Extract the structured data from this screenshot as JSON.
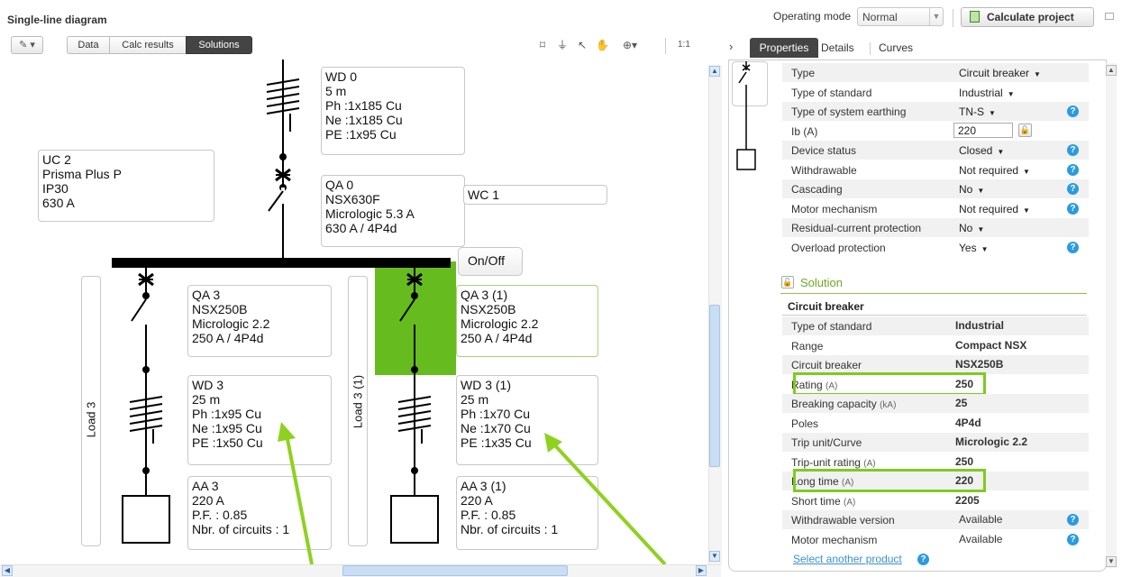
{
  "app": {
    "title": "Single-line diagram"
  },
  "topbar": {
    "operating_mode_label": "Operating mode",
    "operating_mode_value": "Normal",
    "calculate_label": "Calculate project"
  },
  "toolbar": {
    "tabs": [
      "Data",
      "Calc results",
      "Solutions"
    ],
    "active_tab": "Solutions",
    "zoom_reset": "1:1"
  },
  "diagram": {
    "wd0": [
      "WD 0",
      "5 m",
      "Ph :1x185 Cu",
      "Ne :1x185 Cu",
      "PE :1x95 Cu"
    ],
    "uc2": [
      "UC 2",
      "Prisma Plus P",
      "IP30",
      "630 A"
    ],
    "qa0": [
      "QA 0",
      "NSX630F",
      "Micrologic 5.3 A",
      "630 A / 4P4d"
    ],
    "wc1": "WC 1",
    "onoff": "On/Off",
    "qa3": [
      "QA 3",
      "NSX250B",
      "Micrologic 2.2",
      "250 A / 4P4d"
    ],
    "qa3_1": [
      "QA 3 (1)",
      "NSX250B",
      "Micrologic 2.2",
      "250 A / 4P4d"
    ],
    "wd3": [
      "WD 3",
      "25 m",
      "Ph :1x95 Cu",
      "Ne :1x95 Cu",
      "PE :1x50 Cu"
    ],
    "wd3_1": [
      "WD 3 (1)",
      "25 m",
      "Ph :1x70 Cu",
      "Ne :1x70 Cu",
      "PE :1x35 Cu"
    ],
    "aa3": [
      "AA 3",
      "220 A",
      "P.F. : 0.85",
      "Nbr. of circuits : 1"
    ],
    "aa3_1": [
      "AA 3 (1)",
      "220 A",
      "P.F. : 0.85",
      "Nbr. of circuits : 1"
    ],
    "load3": "Load 3",
    "load3_1": "Load 3 (1)",
    "selected_fill_color": "#66bb1e",
    "arrow_color": "#8fd11f"
  },
  "panel": {
    "tabs": [
      "Properties",
      "Details",
      "Curves"
    ],
    "active_tab": "Properties",
    "properties": [
      {
        "label": "Type",
        "value": "Circuit breaker",
        "dropdown": true,
        "help": false
      },
      {
        "label": "Type of standard",
        "value": "Industrial",
        "dropdown": true,
        "help": false
      },
      {
        "label": "Type of system earthing",
        "value": "TN-S",
        "dropdown": true,
        "help": true
      },
      {
        "label": "Ib (A)",
        "value": "220",
        "input": true,
        "help": false
      },
      {
        "label": "Device status",
        "value": "Closed",
        "dropdown": true,
        "help": true
      },
      {
        "label": "Withdrawable",
        "value": "Not required",
        "dropdown": true,
        "help": true
      },
      {
        "label": "Cascading",
        "value": "No",
        "dropdown": true,
        "help": true
      },
      {
        "label": "Motor mechanism",
        "value": "Not required",
        "dropdown": true,
        "help": true
      },
      {
        "label": "Residual-current protection",
        "value": "No",
        "dropdown": true,
        "help": false
      },
      {
        "label": "Overload protection",
        "value": "Yes",
        "dropdown": true,
        "help": true
      }
    ],
    "solution_title": "Solution",
    "circuit_breaker_title": "Circuit breaker",
    "solution_rows": [
      {
        "label": "Type of standard",
        "unit": "",
        "value": "Industrial"
      },
      {
        "label": "Range",
        "unit": "",
        "value": "Compact NSX"
      },
      {
        "label": "Circuit breaker",
        "unit": "",
        "value": "NSX250B"
      },
      {
        "label": "Rating",
        "unit": "(A)",
        "value": "250",
        "highlight": true
      },
      {
        "label": "Breaking capacity",
        "unit": "(kA)",
        "value": "25"
      },
      {
        "label": "Poles",
        "unit": "",
        "value": "4P4d"
      },
      {
        "label": "Trip unit/Curve",
        "unit": "",
        "value": "Micrologic 2.2"
      },
      {
        "label": "Trip-unit rating",
        "unit": "(A)",
        "value": "250"
      },
      {
        "label": "Long time",
        "unit": "(A)",
        "value": "220",
        "highlight": true
      },
      {
        "label": "Short time",
        "unit": "(A)",
        "value": "2205"
      },
      {
        "label": "Withdrawable version",
        "unit": "",
        "value": "Available",
        "plain": true,
        "help": true
      },
      {
        "label": "Motor mechanism",
        "unit": "",
        "value": "Available",
        "plain": true,
        "help": true
      }
    ],
    "select_another": "Select another product"
  }
}
